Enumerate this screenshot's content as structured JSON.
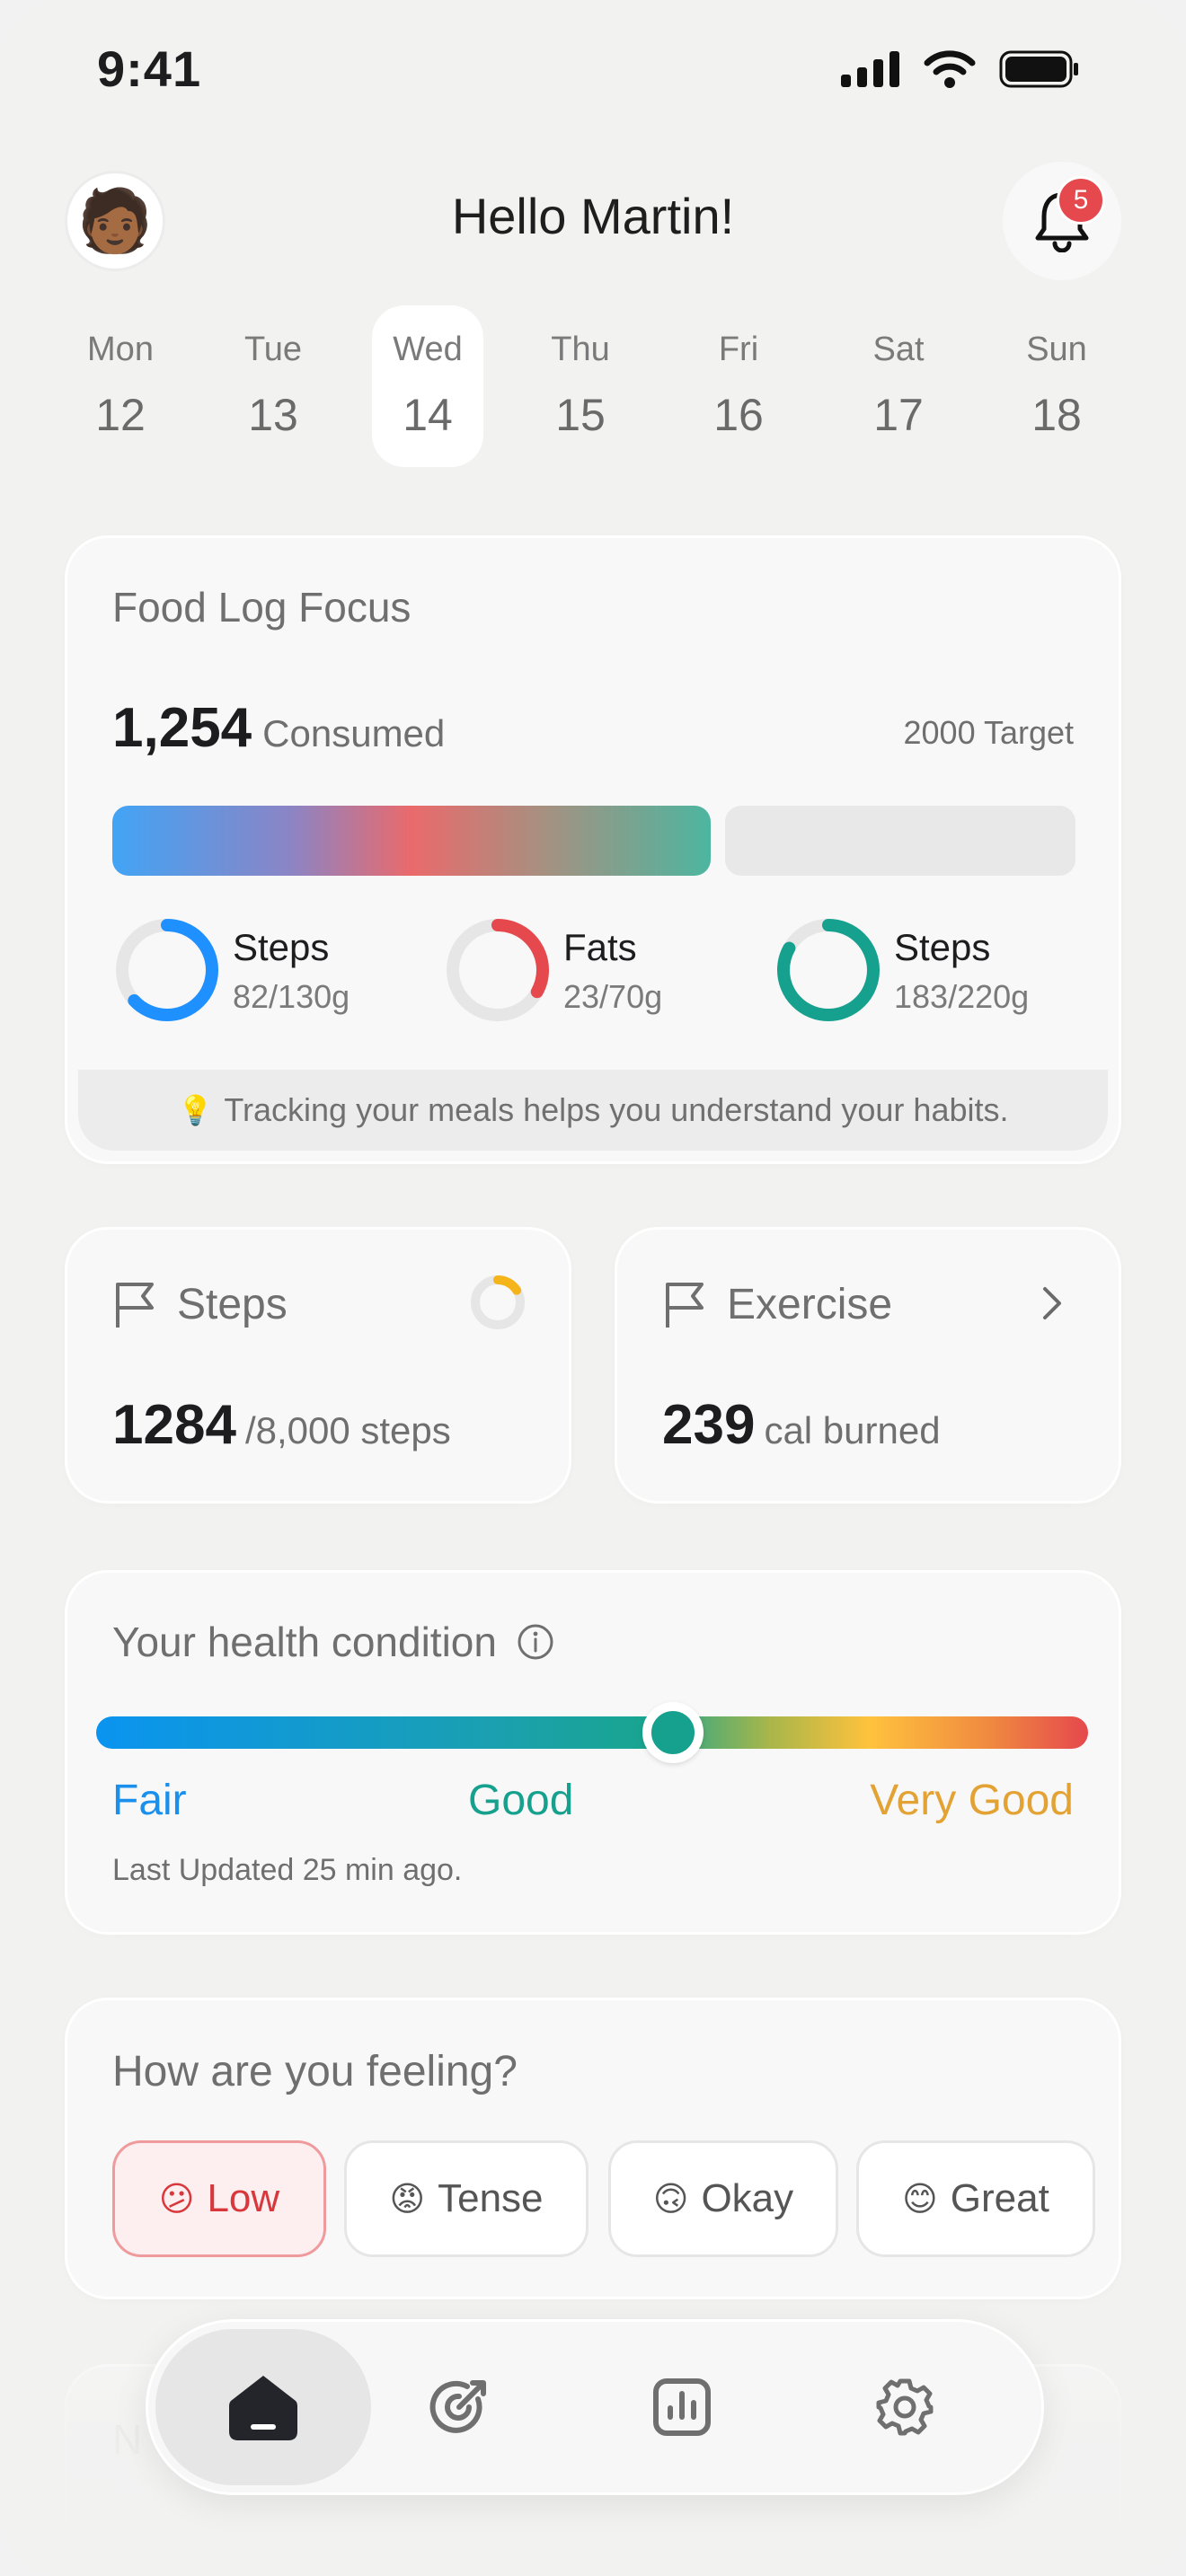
{
  "status": {
    "time": "9:41"
  },
  "header": {
    "greeting": "Hello Martin!",
    "avatar": "🧑🏾",
    "notifications": "5"
  },
  "days": [
    {
      "name": "Mon",
      "date": "12"
    },
    {
      "name": "Tue",
      "date": "13"
    },
    {
      "name": "Wed",
      "date": "14",
      "active": true
    },
    {
      "name": "Thu",
      "date": "15"
    },
    {
      "name": "Fri",
      "date": "16"
    },
    {
      "name": "Sat",
      "date": "17"
    },
    {
      "name": "Sun",
      "date": "18"
    }
  ],
  "food_log": {
    "title": "Food Log Focus",
    "consumed_value": "1,254",
    "consumed_label": "Consumed",
    "target": "2000 Target",
    "progress": 0.627,
    "macros": [
      {
        "name": "Steps",
        "value": "82/130g",
        "fraction": 0.63,
        "color": "#1e90ff"
      },
      {
        "name": "Fats",
        "value": "23/70g",
        "fraction": 0.33,
        "color": "#e5484d"
      },
      {
        "name": "Steps",
        "value": "183/220g",
        "fraction": 0.83,
        "color": "#16a08e"
      }
    ],
    "tip_icon": "💡",
    "tip": "Tracking your meals helps you understand your habits."
  },
  "steps_card": {
    "title": "Steps",
    "value": "1284",
    "unit": "/8,000 steps",
    "progress": 0.16,
    "ring_color": "#f4b41a"
  },
  "exercise_card": {
    "title": "Exercise",
    "value": "239",
    "unit": "cal burned"
  },
  "health": {
    "title": "Your health condition",
    "levels": [
      "Fair",
      "Good",
      "Very Good"
    ],
    "level_colors": [
      "#1a90ec",
      "#16a08e",
      "#e3a234"
    ],
    "updated": "Last Updated 25 min ago.",
    "position": 0.58
  },
  "feeling": {
    "question": "How are you feeling?",
    "options": [
      {
        "emoji": "😕",
        "label": "Low",
        "selected": true
      },
      {
        "emoji": "😡",
        "label": "Tense"
      },
      {
        "emoji": "🙃",
        "label": "Okay"
      },
      {
        "emoji": "😊",
        "label": "Great"
      }
    ]
  },
  "next_card": {
    "title": "N"
  },
  "nav": [
    "home-icon",
    "goal-icon",
    "chart-icon",
    "settings-icon"
  ]
}
